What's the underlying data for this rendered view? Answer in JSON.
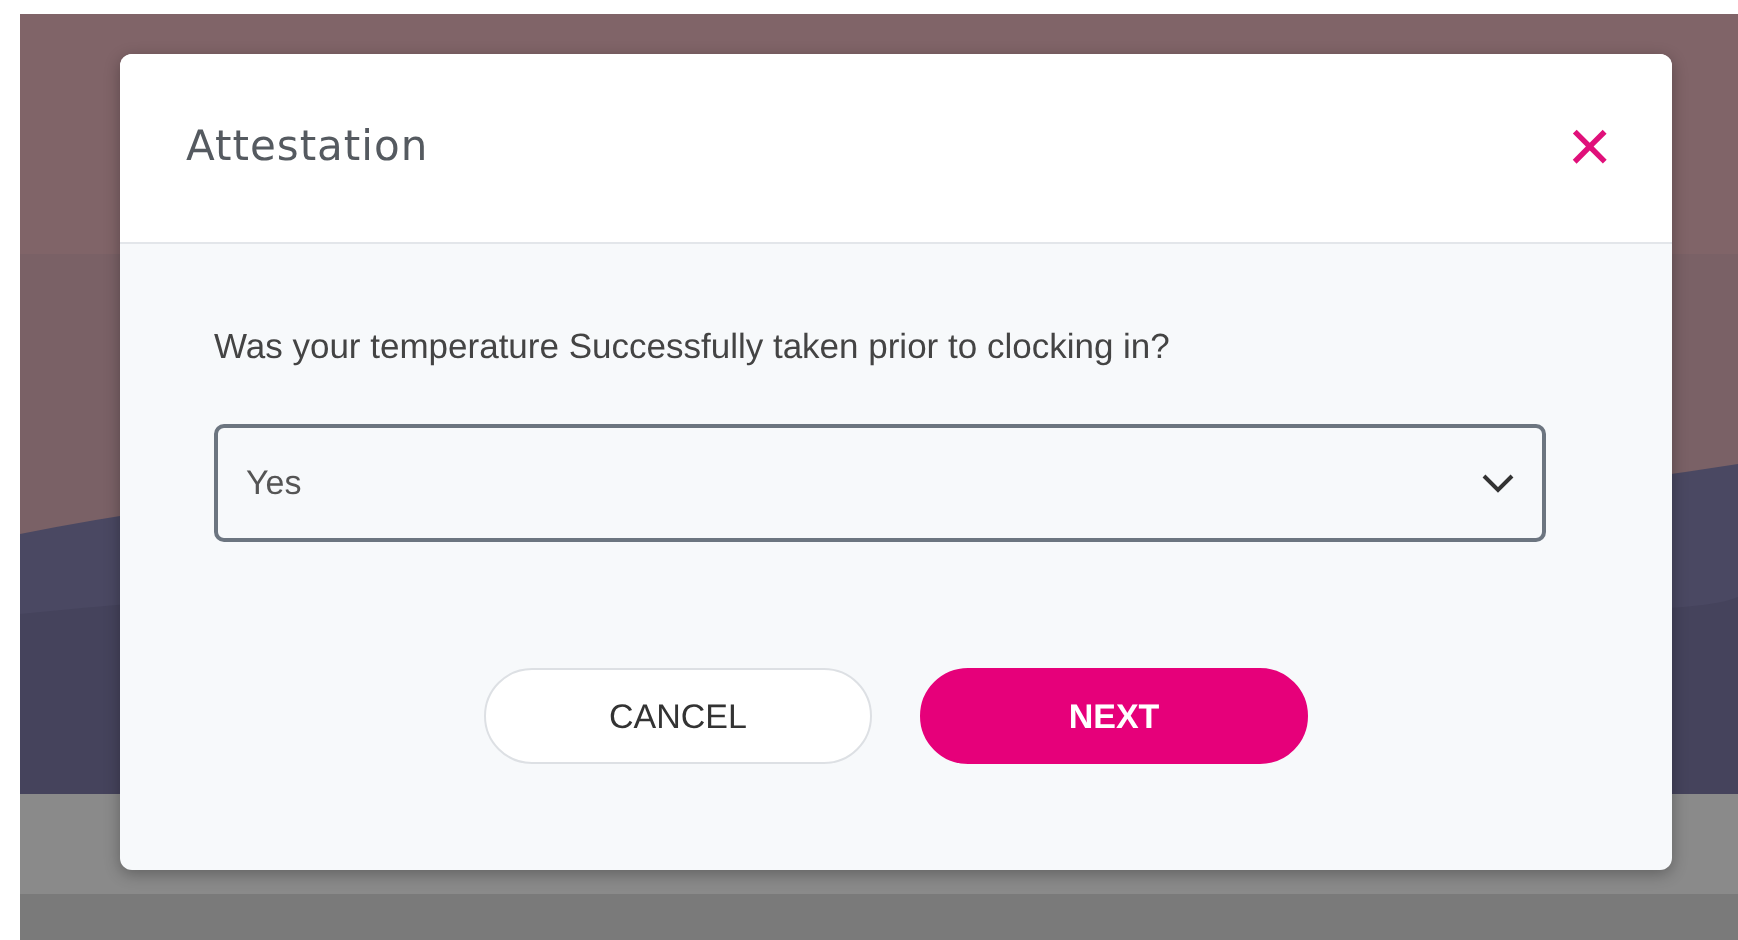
{
  "dialog": {
    "title": "Attestation",
    "close_icon": "×",
    "question": "Was your temperature Successfully taken prior to clocking in?",
    "answer_select": {
      "value": "Yes"
    },
    "buttons": [
      {
        "label": "CANCEL",
        "kind": "secondary"
      },
      {
        "label": "NEXT",
        "kind": "primary"
      }
    ]
  }
}
